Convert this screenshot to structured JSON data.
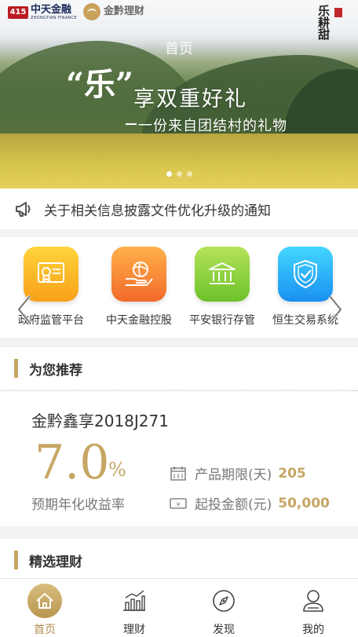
{
  "banner": {
    "logo_zhongtian": "中天金融",
    "logo_zhongtian_en": "ZHONGTIAN FINANCE",
    "logo_badge": "415",
    "logo_qianlicai": "金黔理财",
    "home_title": "首页",
    "slogan_quote": "“乐”",
    "slogan_main": "享双重好礼",
    "slogan_sub": "一份来自团结村的礼物",
    "stamp_text": "乐耕甜",
    "slide_count": 3,
    "active_slide": 0
  },
  "notice": {
    "text": "关于相关信息披露文件优化升级的通知",
    "icon": "megaphone-icon"
  },
  "quick_entries": [
    {
      "label": "政府监管平台",
      "icon": "certificate-icon",
      "color_top": "#ffd43a",
      "color_bottom": "#f8a01a"
    },
    {
      "label": "中天金融控股",
      "icon": "hand-globe-icon",
      "color_top": "#ffb04a",
      "color_bottom": "#f26b2a"
    },
    {
      "label": "平安银行存管",
      "icon": "bank-icon",
      "color_top": "#b5e35a",
      "color_bottom": "#6cc22a"
    },
    {
      "label": "恒生交易系统",
      "icon": "shield-check-icon",
      "color_top": "#43d7ff",
      "color_bottom": "#1a8ff0"
    }
  ],
  "recommend": {
    "section_title": "为您推荐",
    "product_name": "金黔鑫享2018J271",
    "rate": "7.0",
    "rate_unit": "%",
    "rate_label": "预期年化收益率",
    "term_label": "产品期限(天)",
    "term_value": "205",
    "min_label": "起投金额(元)",
    "min_value": "50,000"
  },
  "selected": {
    "section_title": "精选理财"
  },
  "tabs": [
    {
      "label": "首页",
      "icon": "home-icon",
      "active": true
    },
    {
      "label": "理财",
      "icon": "bar-chart-icon",
      "active": false
    },
    {
      "label": "发现",
      "icon": "compass-icon",
      "active": false
    },
    {
      "label": "我的",
      "icon": "user-icon",
      "active": false
    }
  ],
  "colors": {
    "accent": "#c6a664",
    "background": "#f2f2f2",
    "active_tab": "#b18e4c"
  }
}
